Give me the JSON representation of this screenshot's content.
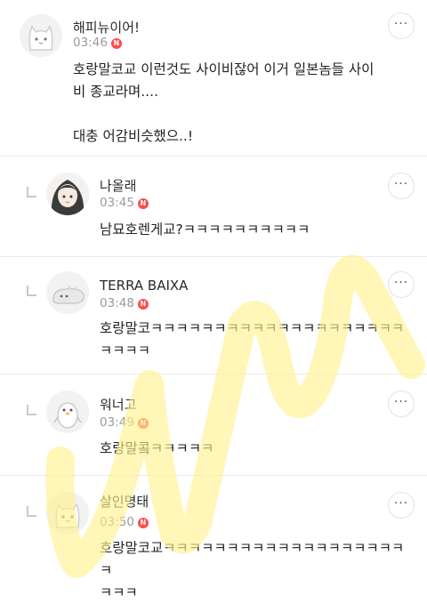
{
  "comments": [
    {
      "author": "해피뉴이어!",
      "time": "03:46",
      "badge": "N",
      "text": "호랑말코교 이런것도 사이비잖어 이거 일본놈들 사이\n비 종교라며....\n\n대충 어감비슷했으..!",
      "more_label": "···",
      "avatar_icon": "cat-face-icon"
    },
    {
      "author": "나올래",
      "time": "03:45",
      "badge": "N",
      "text": "남묘호렌게교?ㅋㅋㅋㅋㅋㅋㅋㅋㅋㅋ",
      "more_label": "···",
      "avatar_icon": "anime-girl-icon"
    },
    {
      "author": "TERRA BAIXA",
      "time": "03:48",
      "badge": "N",
      "text": "호랑말코ㅋㅋㅋㅋㅋㅋㅋㅋㅋㅋㅋㅋㅋㅋㅋㅋㅋㅋㅋㅋ\nㅋㅋㅋㅋ",
      "more_label": "···",
      "avatar_icon": "blob-creature-icon"
    },
    {
      "author": "워너고",
      "time": "03:49",
      "badge": "N",
      "text": "호랑말콬ㅋㅋㅋㅋㅋ",
      "more_label": "···",
      "avatar_icon": "penguin-icon"
    },
    {
      "author": "살인명태",
      "time": "03:50",
      "badge": "N",
      "text": "호랑말코교ㅋㅋㅋㅋㅋㅋㅋㅋㅋㅋㅋㅋㅋㅋㅋㅋㅋㅋㅋㅋ\nㅋㅋㅋ",
      "more_label": "···",
      "avatar_icon": "cat-face-icon"
    }
  ],
  "colors": {
    "badge": "#ff4b4b",
    "watermark": "#fff18a",
    "divider": "#ebebeb",
    "meta": "#9a9a9a"
  }
}
